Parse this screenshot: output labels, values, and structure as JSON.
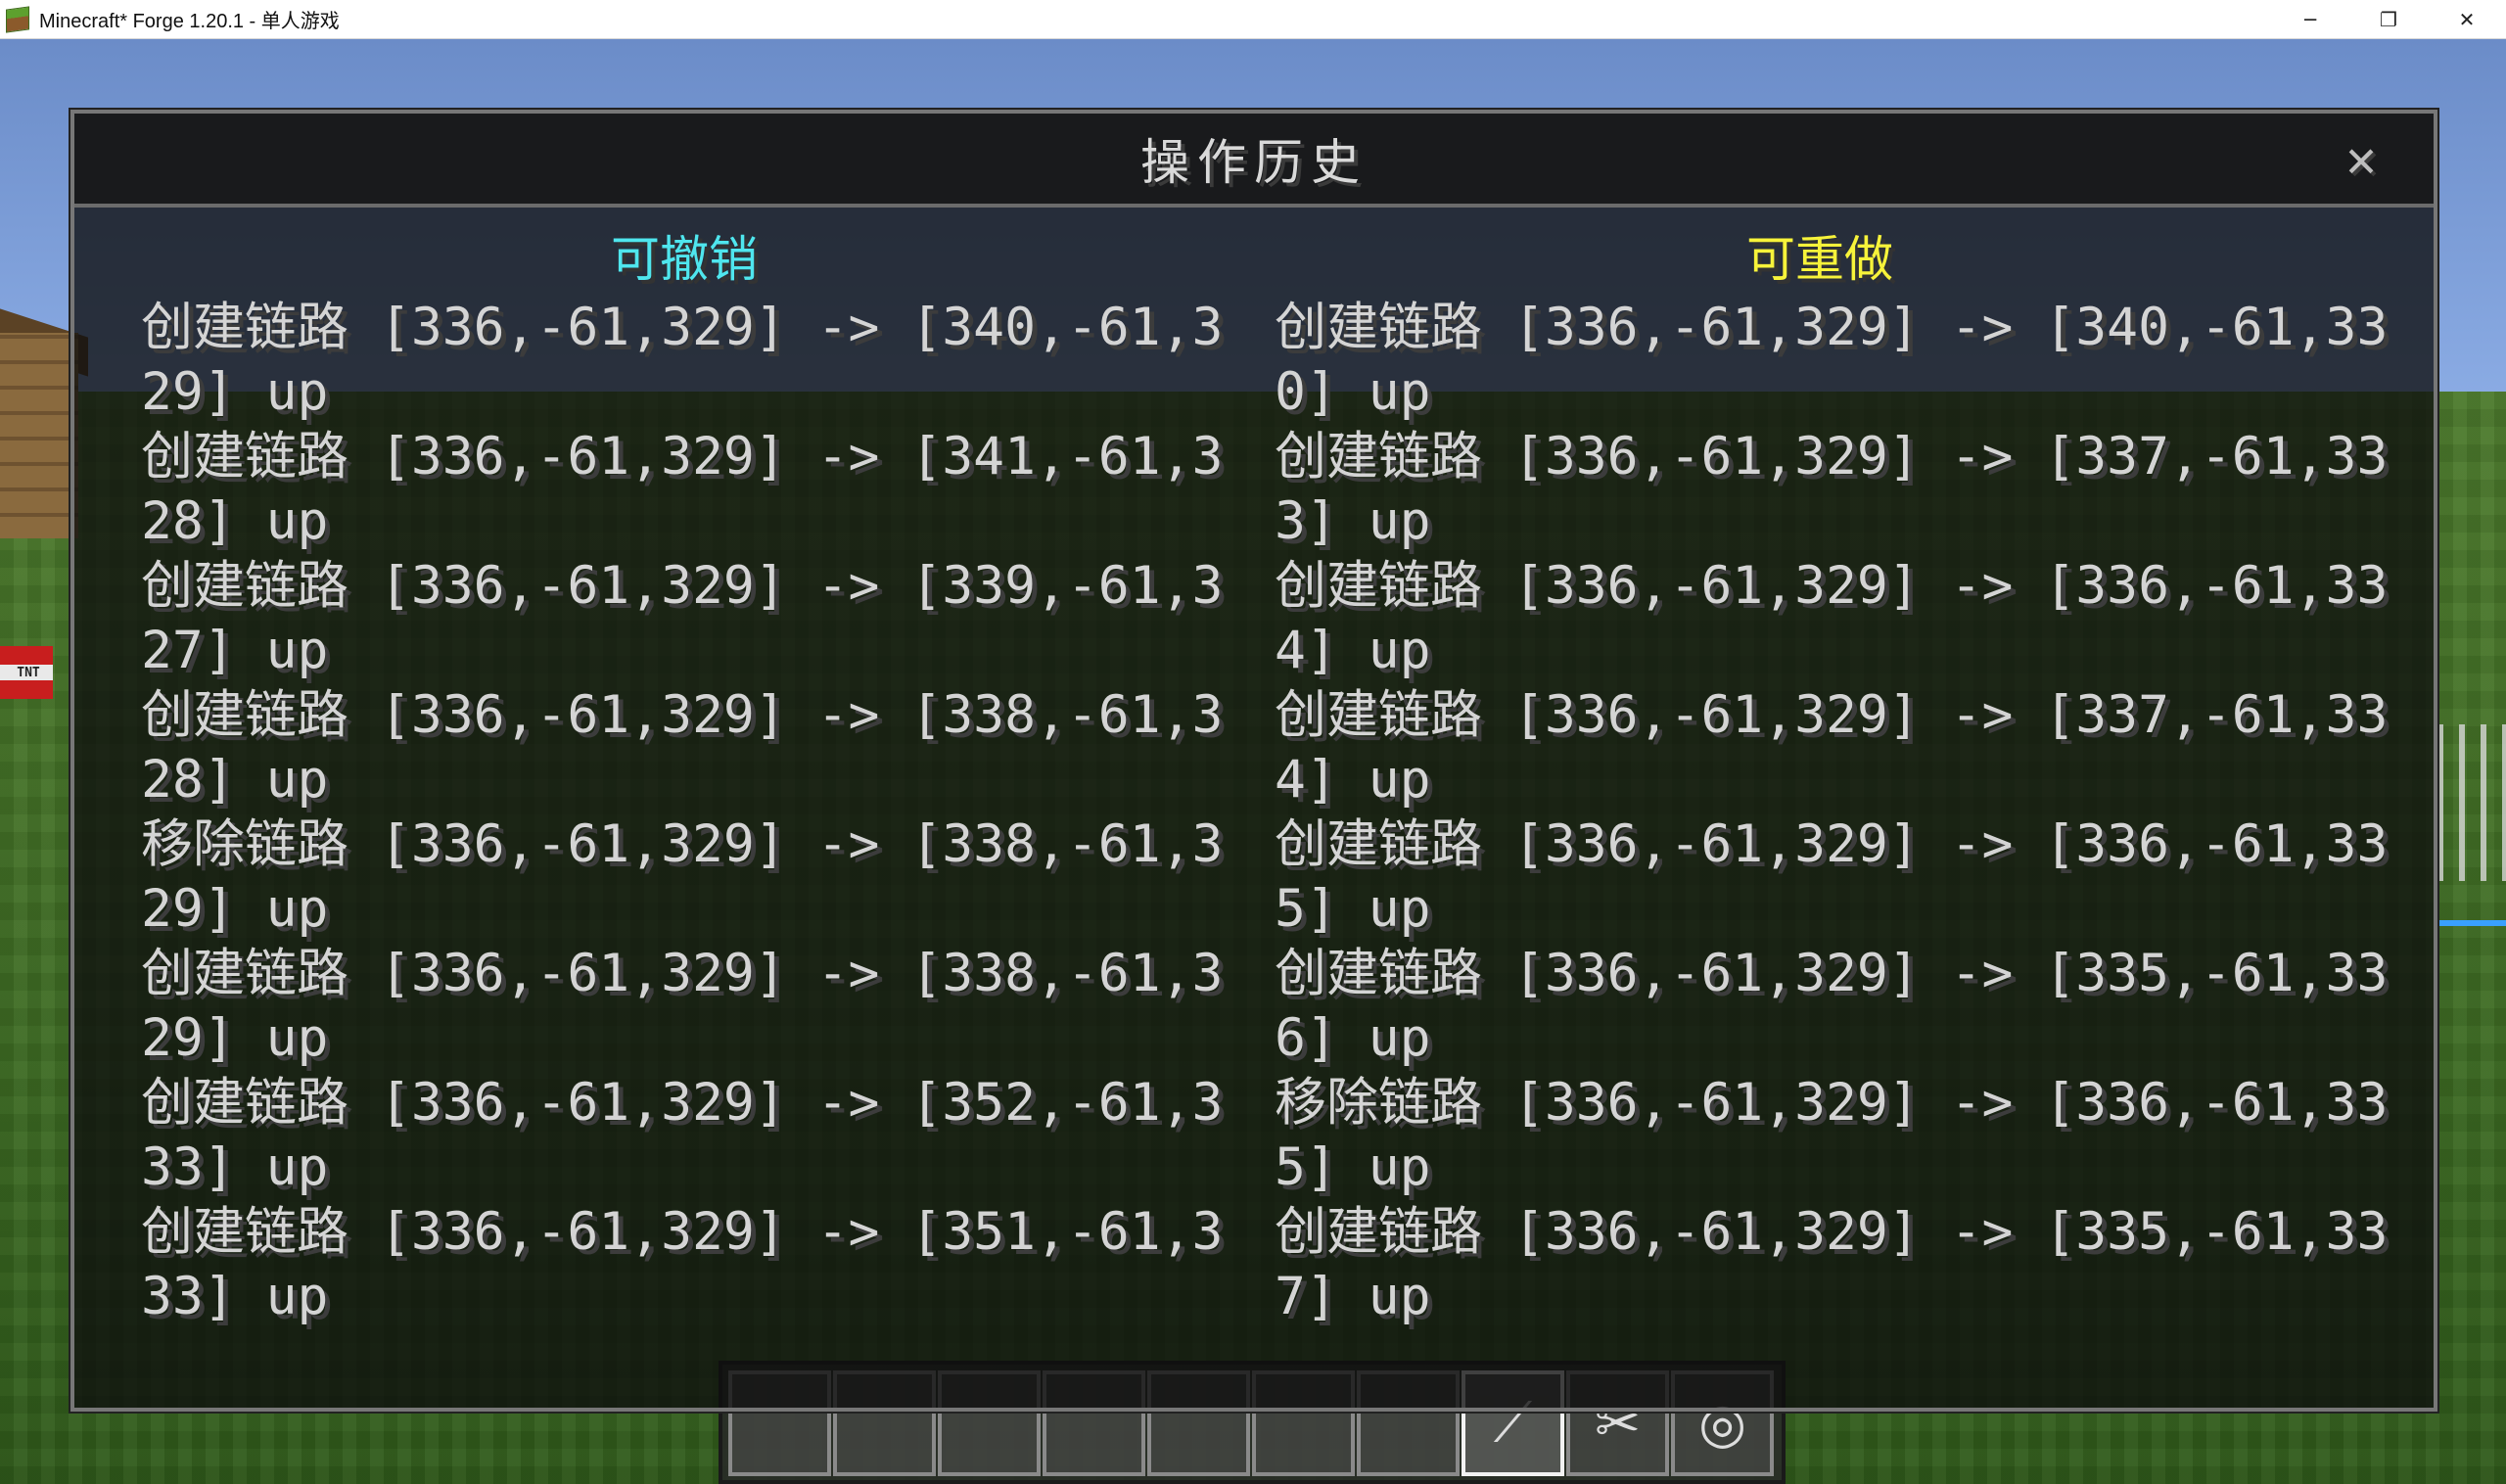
{
  "window": {
    "title": "Minecraft* Forge 1.20.1 - 单人游戏",
    "controls": {
      "minimize": "─",
      "restore": "❐",
      "close": "✕"
    }
  },
  "dialog": {
    "title": "操作历史",
    "close_glyph": "✕",
    "undo_header": "可撤销",
    "redo_header": "可重做",
    "undo_color": "#4fe6ee",
    "redo_color": "#f7f33a",
    "undo_items": [
      "创建链路 [336,-61,329] -> [340,-61,329] up",
      "创建链路 [336,-61,329] -> [341,-61,328] up",
      "创建链路 [336,-61,329] -> [339,-61,327] up",
      "创建链路 [336,-61,329] -> [338,-61,328] up",
      "移除链路 [336,-61,329] -> [338,-61,329] up",
      "创建链路 [336,-61,329] -> [338,-61,329] up",
      "创建链路 [336,-61,329] -> [352,-61,333] up",
      "创建链路 [336,-61,329] -> [351,-61,333] up"
    ],
    "redo_items": [
      "创建链路 [336,-61,329] -> [340,-61,330] up",
      "创建链路 [336,-61,329] -> [337,-61,333] up",
      "创建链路 [336,-61,329] -> [336,-61,334] up",
      "创建链路 [336,-61,329] -> [337,-61,334] up",
      "创建链路 [336,-61,329] -> [336,-61,335] up",
      "创建链路 [336,-61,329] -> [335,-61,336] up",
      "移除链路 [336,-61,329] -> [336,-61,335] up",
      "创建链路 [336,-61,329] -> [335,-61,337] up"
    ]
  },
  "hotbar": {
    "selected_slot": 7,
    "slots": [
      "",
      "",
      "",
      "",
      "",
      "",
      "",
      "fishing-rod-icon",
      "shears-icon",
      "lead-icon"
    ]
  },
  "world": {
    "tnt_label": "TNT"
  }
}
